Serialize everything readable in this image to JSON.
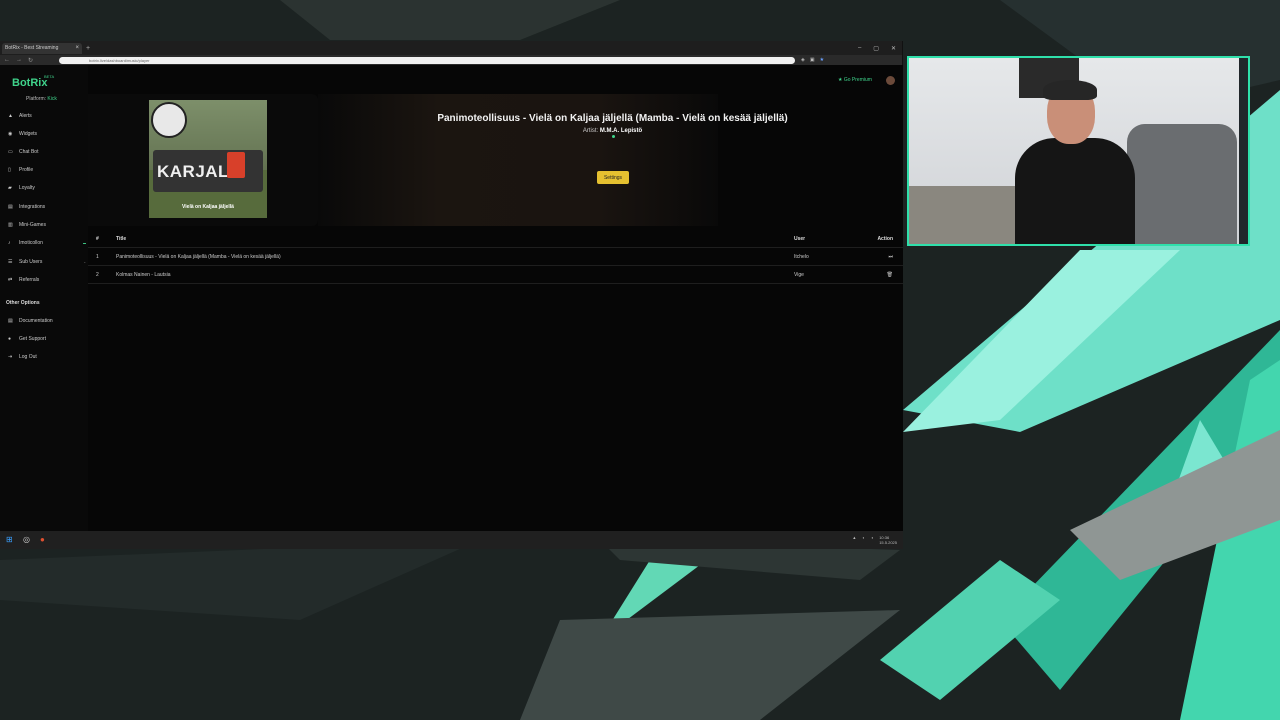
{
  "browser": {
    "tab_title": "BotRix - Best Streaming",
    "address": "botrix.live/dashboard/music/player",
    "window_controls": [
      "–",
      "▢",
      "✕"
    ]
  },
  "app": {
    "logo": "BotRix",
    "beta": "BETA",
    "platform_label": "Platform:",
    "platform_value": "Kick",
    "go_premium": "Go Premium",
    "nav": [
      {
        "label": "Alerts",
        "icon": "bell-icon"
      },
      {
        "label": "Widgets",
        "icon": "widgets-icon"
      },
      {
        "label": "Chat Bot",
        "icon": "chat-icon"
      },
      {
        "label": "Profile",
        "icon": "user-icon"
      },
      {
        "label": "Loyalty",
        "icon": "gift-icon"
      },
      {
        "label": "Integrations",
        "icon": "plug-icon"
      },
      {
        "label": "Mini-Games",
        "icon": "gamepad-icon"
      },
      {
        "label": "Imoticollon",
        "icon": "music-icon"
      },
      {
        "label": "Sub Users",
        "icon": "users-icon"
      },
      {
        "label": "Referrals",
        "icon": "share-icon"
      }
    ],
    "other_options_heading": "Other Options",
    "other_nav": [
      {
        "label": "Documentation",
        "icon": "doc-icon"
      },
      {
        "label": "Get Support",
        "icon": "help-icon"
      },
      {
        "label": "Log Out",
        "icon": "logout-icon"
      }
    ]
  },
  "player": {
    "cover_title": "KARJALA",
    "cover_subtitle": "Vielä on Kaljaa jäljellä",
    "song_title": "Panimoteollisuus - Vielä on Kaljaa jäljellä (Mamba - Vielä on kesää jäljellä)",
    "artist_label": "Artist:",
    "artist_value": "M.M.A. Lepistö",
    "settings_button": "Settings"
  },
  "queue": {
    "headers": {
      "num": "#",
      "title": "Title",
      "user": "User",
      "action": "Action"
    },
    "rows": [
      {
        "num": "1",
        "title": "Panimoteollisuus - Vielä on Kaljaa jäljellä (Mamba - Vielä on kesää jäljellä)",
        "user": "Itchelo",
        "action": "⏭"
      },
      {
        "num": "2",
        "title": "Kolmas Nainen - Lautsia",
        "user": "Vige",
        "action": "🗑"
      }
    ]
  },
  "taskbar": {
    "time": "10:36",
    "date": "15.5.2025"
  },
  "colors": {
    "accent": "#3fd38b",
    "settings_button": "#e5c030",
    "cam_border": "#2fe0ab"
  }
}
